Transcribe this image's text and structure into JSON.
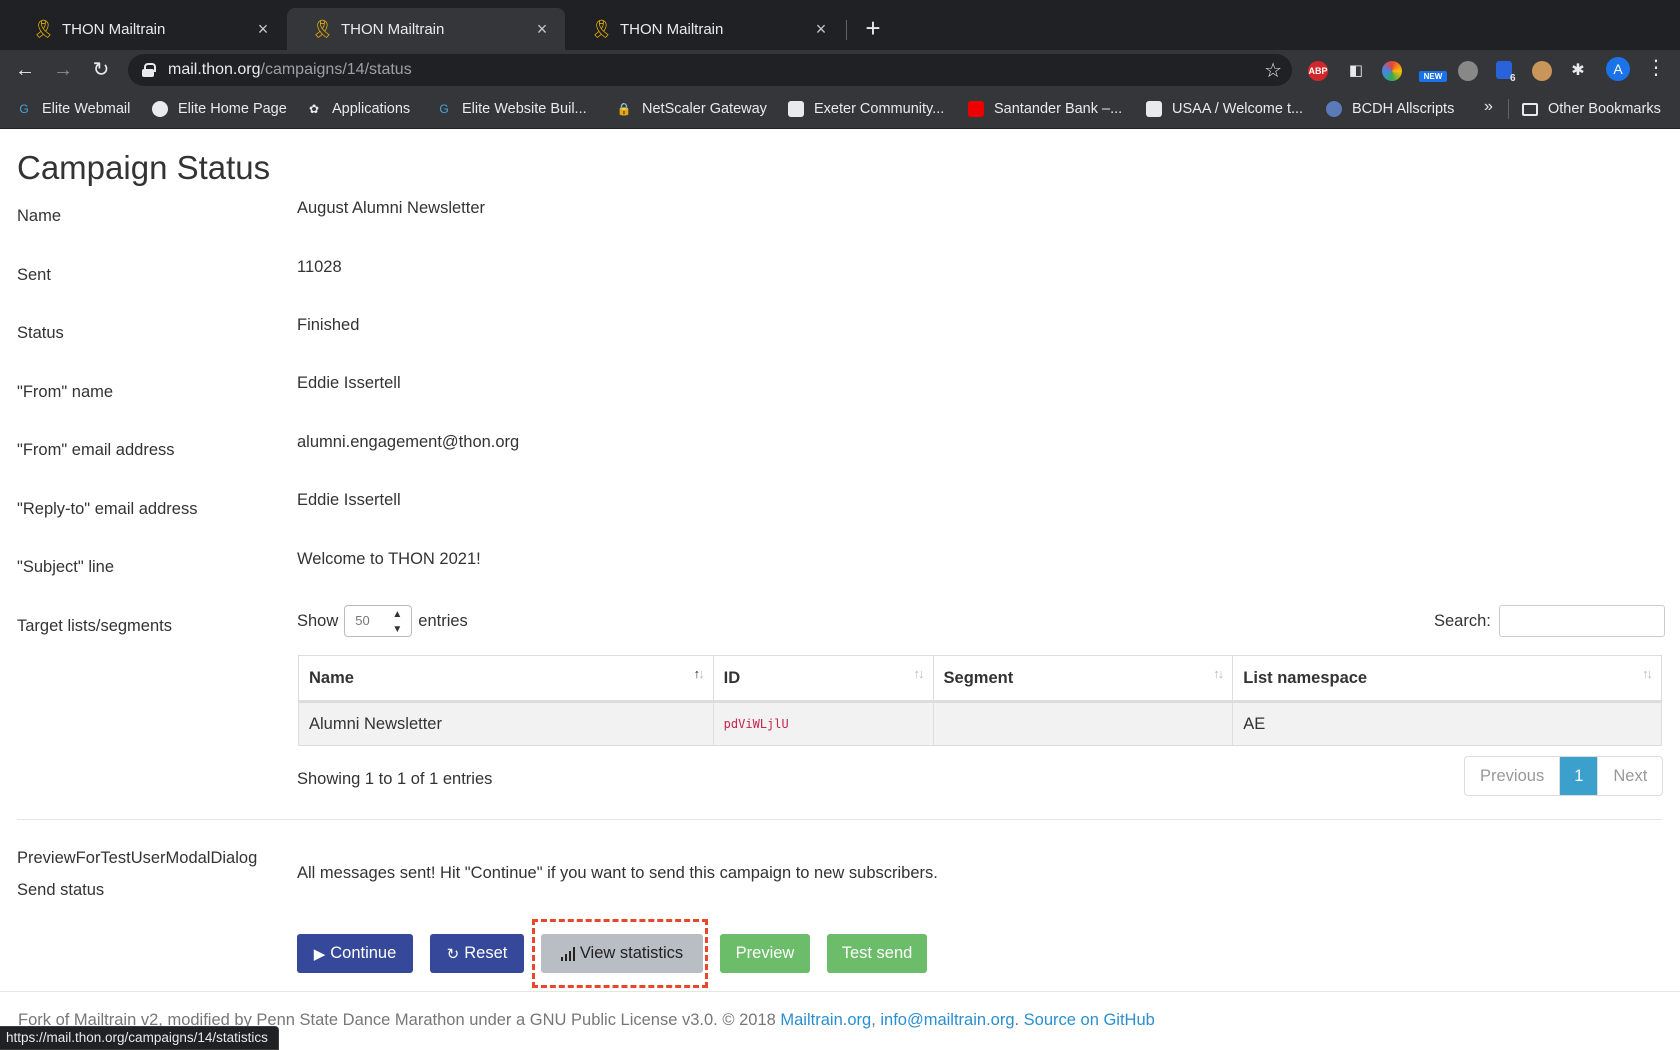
{
  "browser": {
    "tabs": [
      {
        "title": "THON Mailtrain",
        "close": "×"
      },
      {
        "title": "THON Mailtrain",
        "close": "×"
      },
      {
        "title": "THON Mailtrain",
        "close": "×"
      }
    ],
    "new_tab": "+",
    "url_host": "mail.thon.org",
    "url_path": "/campaigns/14/status",
    "bookmarks": [
      {
        "label": "Elite Webmail",
        "icon": "elite-icon"
      },
      {
        "label": "Elite Home Page",
        "icon": "globe-icon"
      },
      {
        "label": "Applications",
        "icon": "apps-icon"
      },
      {
        "label": "Elite Website Buil...",
        "icon": "elite-icon"
      },
      {
        "label": "NetScaler Gateway",
        "icon": "lock-icon"
      },
      {
        "label": "Exeter Community...",
        "icon": "bank-icon"
      },
      {
        "label": "Santander Bank –...",
        "icon": "santander-icon"
      },
      {
        "label": "USAA / Welcome t...",
        "icon": "usaa-icon"
      },
      {
        "label": "BCDH Allscripts",
        "icon": "bcdh-icon"
      }
    ],
    "bookmarks_more": "»",
    "other_bookmarks": "Other Bookmarks",
    "ext_abp": "ABP",
    "ext_new": "NEW",
    "ext_badge": "6",
    "avatar_letter": "A",
    "status_url": "https://mail.thon.org/campaigns/14/statistics"
  },
  "page": {
    "title": "Campaign Status",
    "fields": [
      {
        "label": "Name",
        "value": "August Alumni Newsletter"
      },
      {
        "label": "Sent",
        "value": "11028"
      },
      {
        "label": "Status",
        "value": "Finished"
      },
      {
        "label": "\"From\" name",
        "value": "Eddie Issertell"
      },
      {
        "label": "\"From\" email address",
        "value": "alumni.engagement@thon.org"
      },
      {
        "label": "\"Reply-to\" email address",
        "value": "Eddie Issertell"
      },
      {
        "label": "\"Subject\" line",
        "value": "Welcome to THON 2021!"
      }
    ],
    "target_label": "Target lists/segments",
    "table": {
      "show_label": "Show",
      "entries_value": "50",
      "entries_label": "entries",
      "search_label": "Search:",
      "columns": [
        "Name",
        "ID",
        "Segment",
        "List namespace"
      ],
      "rows": [
        {
          "name": "Alumni Newsletter",
          "id": "pdViWLjlU",
          "segment": "",
          "namespace": "AE"
        }
      ],
      "showing": "Showing 1 to 1 of 1 entries",
      "prev": "Previous",
      "page": "1",
      "next": "Next"
    },
    "preview_modal_label": "PreviewForTestUserModalDialog",
    "send_status_label": "Send status",
    "send_status_message": "All messages sent! Hit \"Continue\" if you want to send this campaign to new subscribers.",
    "buttons": {
      "continue": "Continue",
      "reset": "Reset",
      "view_statistics": "View statistics",
      "preview": "Preview",
      "test_send": "Test send"
    },
    "footer": {
      "text": "Fork of Mailtrain v2, modified by Penn State Dance Marathon under a GNU Public License v3.0. © 2018 ",
      "link1": "Mailtrain.org",
      "sep1": ", ",
      "link2": "info@mailtrain.org",
      "sep2": ". ",
      "link3": "Source on GitHub"
    }
  },
  "colors": {
    "primary": "#35489a",
    "success": "#6cbd6a",
    "default": "#b9bdc4",
    "link": "#2a8fd0",
    "highlight": "#e8472b",
    "pager_active": "#3ca0cc"
  }
}
